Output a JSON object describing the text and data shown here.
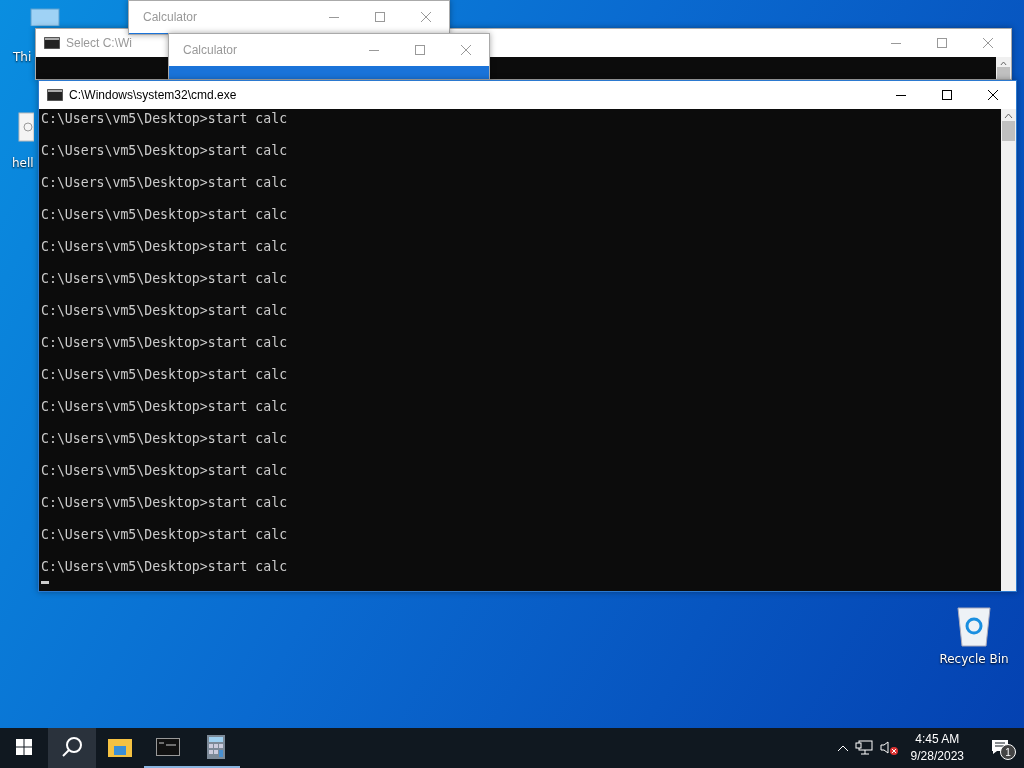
{
  "desktop_icons": [
    {
      "kind": "pc",
      "label": "Thi"
    },
    {
      "kind": "file",
      "label": "hell"
    },
    {
      "kind": "bin",
      "label": "Recycle Bin"
    }
  ],
  "windows": [
    {
      "kind": "console",
      "title": "Select C:\\Wi",
      "active": false
    },
    {
      "kind": "calculator",
      "title": "Calculator",
      "active": false
    },
    {
      "kind": "calculator",
      "title": "Calculator",
      "active": false
    },
    {
      "kind": "console",
      "title": "C:\\Windows\\system32\\cmd.exe",
      "active": true,
      "lines": [
        "C:\\Users\\vm5\\Desktop>start calc",
        "C:\\Users\\vm5\\Desktop>start calc",
        "C:\\Users\\vm5\\Desktop>start calc",
        "C:\\Users\\vm5\\Desktop>start calc",
        "C:\\Users\\vm5\\Desktop>start calc",
        "C:\\Users\\vm5\\Desktop>start calc",
        "C:\\Users\\vm5\\Desktop>start calc",
        "C:\\Users\\vm5\\Desktop>start calc",
        "C:\\Users\\vm5\\Desktop>start calc",
        "C:\\Users\\vm5\\Desktop>start calc",
        "C:\\Users\\vm5\\Desktop>start calc",
        "C:\\Users\\vm5\\Desktop>start calc",
        "C:\\Users\\vm5\\Desktop>start calc",
        "C:\\Users\\vm5\\Desktop>start calc",
        "C:\\Users\\vm5\\Desktop>start calc"
      ]
    }
  ],
  "taskbar": {
    "time": "4:45 AM",
    "date": "9/28/2023",
    "notification_count": "1"
  }
}
